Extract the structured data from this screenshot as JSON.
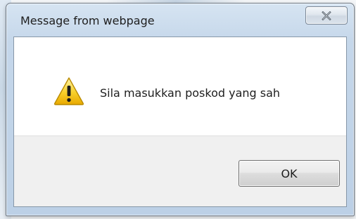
{
  "dialog": {
    "title": "Message from webpage",
    "message": "Sila masukkan poskod yang sah",
    "ok_label": "OK",
    "close_icon": "close-icon",
    "alert_icon": "warning-icon"
  },
  "colors": {
    "frame_blue": "#c5d7ea",
    "button_bar": "#f0f0f0",
    "warning_yellow": "#f5c400"
  }
}
